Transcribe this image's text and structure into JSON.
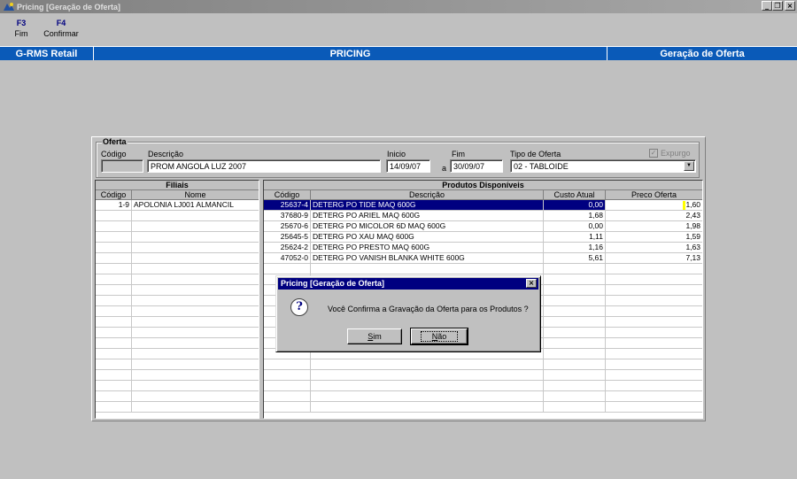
{
  "window": {
    "title": "Pricing [Geração de Oferta]"
  },
  "fkeys": [
    {
      "key": "F3",
      "label": "Fim"
    },
    {
      "key": "F4",
      "label": "Confirmar"
    }
  ],
  "header": {
    "left": "G-RMS Retail",
    "center": "PRICING",
    "right": "Geração de Oferta"
  },
  "oferta": {
    "group_title": "Oferta",
    "codigo_label": "Código",
    "codigo_value": "",
    "descricao_label": "Descrição",
    "descricao_value": "PROM ANGOLA LUZ 2007",
    "inicio_label": "Inicio",
    "inicio_value": "14/09/07",
    "a_label": "a",
    "fim_label": "Fim",
    "fim_value": "30/09/07",
    "tipo_label": "Tipo de Oferta",
    "tipo_value": "02 - TABLOIDE",
    "expurgo_label": "Expurgo"
  },
  "filiais": {
    "title": "Filiais",
    "col_codigo": "Código",
    "col_nome": "Nome",
    "rows": [
      {
        "codigo": "1-9",
        "nome": "APOLONIA LJ001 ALMANCIL"
      }
    ]
  },
  "produtos": {
    "title": "Produtos Disponíveis",
    "col_codigo": "Código",
    "col_descricao": "Descrição",
    "col_custo": "Custo Atual",
    "col_preco": "Preco Oferta",
    "rows": [
      {
        "codigo": "25637-4",
        "descricao": "DETERG PO TIDE MAQ 600G",
        "custo": "0,00",
        "preco": "1,60"
      },
      {
        "codigo": "37680-9",
        "descricao": "DETERG PO ARIEL MAQ 600G",
        "custo": "1,68",
        "preco": "2,43"
      },
      {
        "codigo": "25670-6",
        "descricao": "DETERG PO MICOLOR 6D MAQ 600G",
        "custo": "0,00",
        "preco": "1,98"
      },
      {
        "codigo": "25645-5",
        "descricao": "DETERG PO XAU MAQ 600G",
        "custo": "1,11",
        "preco": "1,59"
      },
      {
        "codigo": "25624-2",
        "descricao": "DETERG PO PRESTO MAQ 600G",
        "custo": "1,16",
        "preco": "1,63"
      },
      {
        "codigo": "47052-0",
        "descricao": "DETERG PO VANISH BLANKA WHITE 600G",
        "custo": "5,61",
        "preco": "7,13"
      }
    ]
  },
  "dialog": {
    "title": "Pricing [Geração de Oferta]",
    "message": "Você Confirma a Gravação da Oferta para os Produtos ?",
    "yes_label": "Sim",
    "no_label": "Não"
  }
}
